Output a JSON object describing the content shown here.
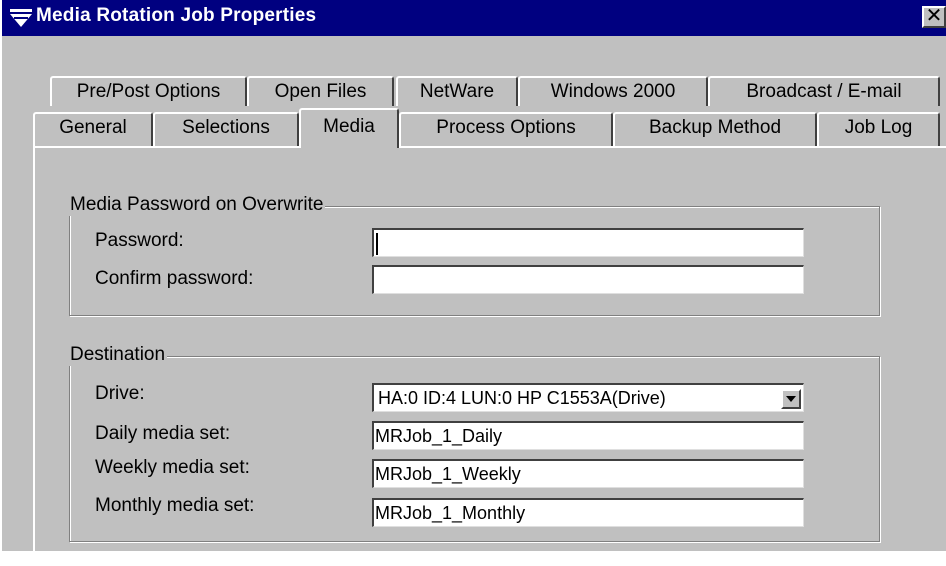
{
  "window": {
    "title": "Media Rotation Job Properties",
    "close_label": "✕"
  },
  "tabs_back": [
    {
      "label": "Pre/Post Options"
    },
    {
      "label": "Open Files"
    },
    {
      "label": "NetWare"
    },
    {
      "label": "Windows 2000"
    },
    {
      "label": "Broadcast / E-mail"
    }
  ],
  "tabs_front": [
    {
      "label": "General"
    },
    {
      "label": "Selections"
    },
    {
      "label": "Media",
      "active": true
    },
    {
      "label": "Process Options"
    },
    {
      "label": "Backup Method"
    },
    {
      "label": "Job Log"
    }
  ],
  "password_group": {
    "legend": "Media Password on Overwrite",
    "password_label": "Password:",
    "password_value": "",
    "confirm_label": "Confirm password:",
    "confirm_value": ""
  },
  "destination_group": {
    "legend": "Destination",
    "drive_label": "Drive:",
    "drive_value": "HA:0 ID:4 LUN:0 HP C1553A(Drive)",
    "daily_label": "Daily media set:",
    "daily_value": "MRJob_1_Daily",
    "weekly_label": "Weekly media set:",
    "weekly_value": "MRJob_1_Weekly",
    "monthly_label": "Monthly media set:",
    "monthly_value": "MRJob_1_Monthly"
  }
}
